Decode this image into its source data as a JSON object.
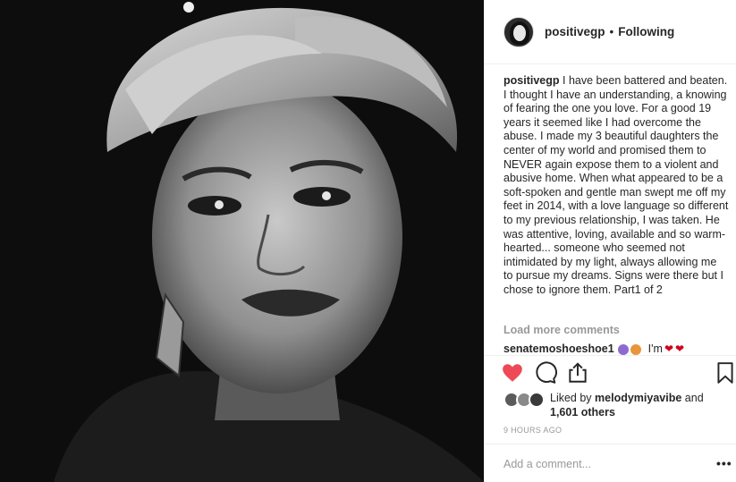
{
  "post": {
    "username": "positivegp",
    "separator": "•",
    "follow_status": "Following",
    "caption_user": "positivegp",
    "caption_text": "I have been battered and beaten. I thought I have an understanding, a knowing of fearing the one you love. For a good 19 years it seemed like I had overcome the abuse. I made my 3 beautiful daughters the center of my world and promised them to NEVER again expose them to a violent and abusive home. When what appeared to be a soft-spoken and gentle man swept me off my feet in 2014, with a love language so different to my previous relationship, I was taken. He was attentive, loving, available and so warm-hearted... someone who seemed not intimidated by my light, always allowing me to pursue my dreams. Signs were there but I chose to ignore them. Part1 of 2",
    "load_more": "Load more comments",
    "first_comment_user": "senatemoshoeshoe1",
    "first_comment_text": "I'm",
    "likes_prefix": "Liked by",
    "likes_user": "melodymiyavibe",
    "likes_and": "and",
    "likes_others": "1,601 others",
    "timestamp": "9 HOURS AGO",
    "add_comment_placeholder": "Add a comment...",
    "more_options": "•••"
  },
  "colors": {
    "like_red": "#ed4956",
    "text": "#262626",
    "muted": "#999999",
    "border": "#efefef"
  },
  "icons": [
    "heart-icon",
    "comment-icon",
    "share-icon",
    "bookmark-icon",
    "more-options-icon"
  ]
}
